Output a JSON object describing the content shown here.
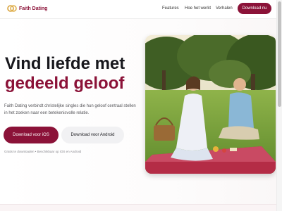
{
  "brand": {
    "name": "Faith Dating",
    "accent": "#8b1238"
  },
  "nav": {
    "links": [
      "Features",
      "Hoe het werkt",
      "Verhalen"
    ],
    "cta": "Download nu"
  },
  "hero": {
    "title_line1": "Vind liefde met",
    "title_line2": "gedeeld geloof",
    "lead": "Faith Dating verbindt christelijke singles die hun geloof centraal stellen in het zoeken naar een betekenisvolle relatie.",
    "btn_ios": "Download voor iOS",
    "btn_android": "Download voor Android",
    "small_note": "Gratis te downloaden • Beschikbaar op iOS en Android"
  },
  "icons": {
    "logo": "rings-icon"
  }
}
